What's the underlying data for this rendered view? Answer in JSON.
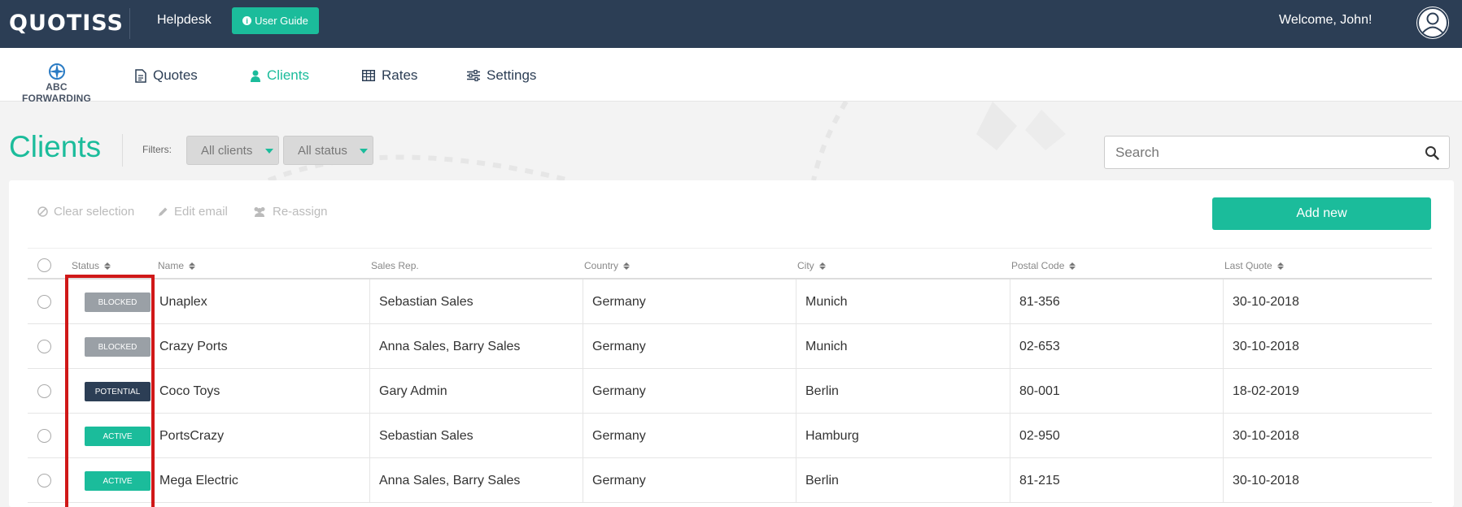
{
  "topbar": {
    "logo": "QUOTISS",
    "helpdesk": "Helpdesk",
    "user_guide": "User Guide",
    "welcome": "Welcome, John!"
  },
  "navbar": {
    "company": "ABC FORWARDING",
    "items": [
      {
        "label": "Quotes",
        "icon": "document-icon",
        "active": false
      },
      {
        "label": "Clients",
        "icon": "person-icon",
        "active": true
      },
      {
        "label": "Rates",
        "icon": "table-icon",
        "active": false
      },
      {
        "label": "Settings",
        "icon": "sliders-icon",
        "active": false
      }
    ]
  },
  "page": {
    "title": "Clients",
    "filters_label": "Filters:",
    "client_filter": "All clients",
    "status_filter": "All status",
    "search_placeholder": "Search"
  },
  "toolbar": {
    "clear_selection": "Clear selection",
    "edit_email": "Edit email",
    "reassign": "Re-assign",
    "add_new": "Add new"
  },
  "table": {
    "columns": [
      "Status",
      "Name",
      "Sales Rep.",
      "Country",
      "City",
      "Postal Code",
      "Last Quote"
    ],
    "rows": [
      {
        "status": "BLOCKED",
        "name": "Unaplex",
        "sales_rep": "Sebastian Sales",
        "country": "Germany",
        "city": "Munich",
        "postal": "81-356",
        "last_quote": "30-10-2018"
      },
      {
        "status": "BLOCKED",
        "name": "Crazy Ports",
        "sales_rep": "Anna Sales, Barry Sales",
        "country": "Germany",
        "city": "Munich",
        "postal": "02-653",
        "last_quote": "30-10-2018"
      },
      {
        "status": "POTENTIAL",
        "name": "Coco Toys",
        "sales_rep": "Gary Admin",
        "country": "Germany",
        "city": "Berlin",
        "postal": "80-001",
        "last_quote": "18-02-2019"
      },
      {
        "status": "ACTIVE",
        "name": "PortsCrazy",
        "sales_rep": "Sebastian Sales",
        "country": "Germany",
        "city": "Hamburg",
        "postal": "02-950",
        "last_quote": "30-10-2018"
      },
      {
        "status": "ACTIVE",
        "name": "Mega Electric",
        "sales_rep": "Anna Sales, Barry Sales",
        "country": "Germany",
        "city": "Berlin",
        "postal": "81-215",
        "last_quote": "30-10-2018"
      }
    ]
  },
  "colors": {
    "topbar": "#2c3e55",
    "accent": "#1bbc9b",
    "blocked": "#9aa0a6",
    "potential": "#2c3e55",
    "active": "#1bbc9b",
    "highlight": "#d01818"
  }
}
